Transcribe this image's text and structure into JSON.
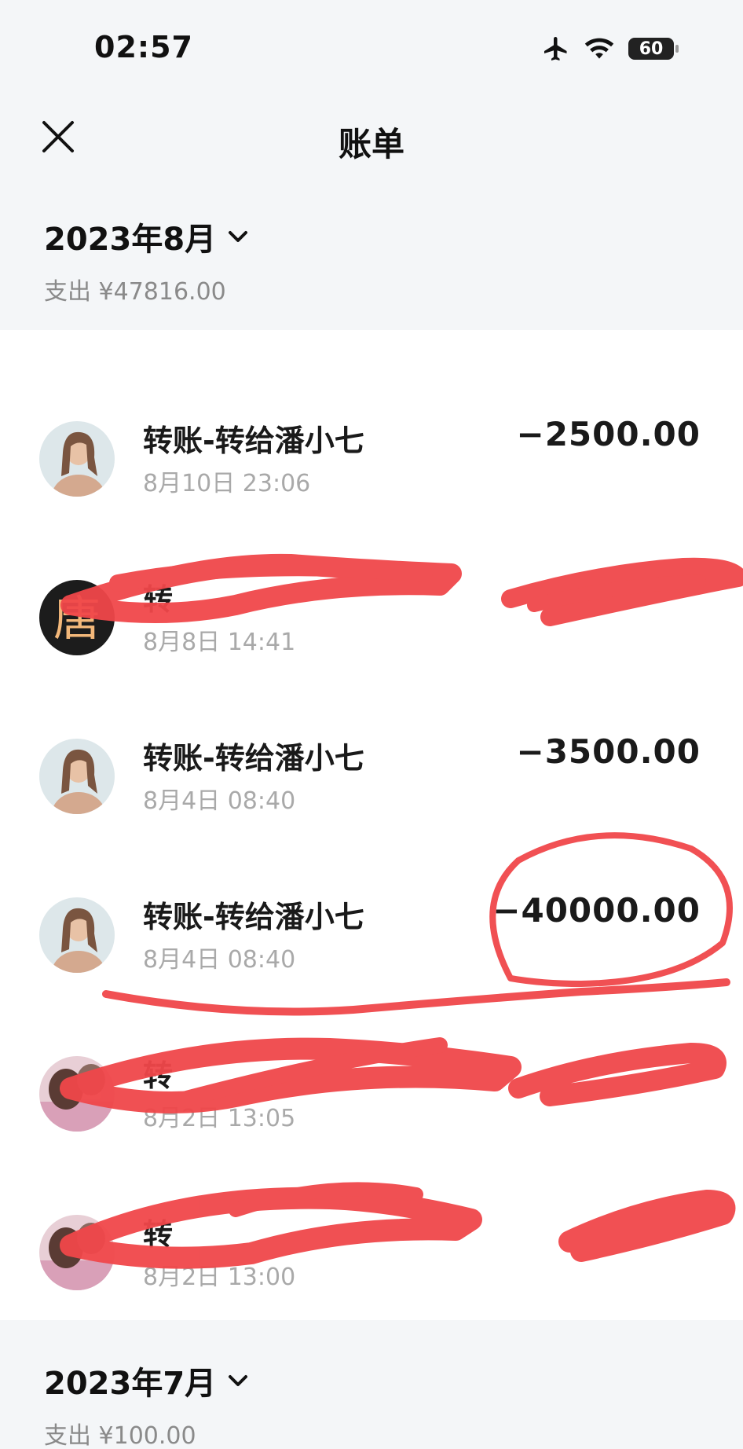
{
  "status_bar": {
    "time": "02:57",
    "battery": "60",
    "icons": [
      "airplane-icon",
      "wifi-icon",
      "battery-icon"
    ]
  },
  "nav": {
    "title": "账单",
    "close_icon": "close-icon"
  },
  "months": [
    {
      "title": "2023年8月",
      "expense": "支出 ¥47816.00"
    },
    {
      "title": "2023年7月",
      "expense": "支出 ¥100.00"
    }
  ],
  "transactions": [
    {
      "title": "转账-转给潘小七",
      "time": "8月10日 23:06",
      "amount": "−2500.00",
      "avatar": "avatar-photo-girl",
      "redacted": false
    },
    {
      "title": "转",
      "time": "8月8日 14:41",
      "amount": "",
      "avatar": "avatar-tang",
      "avatar_text": "唐",
      "redacted": true
    },
    {
      "title": "转账-转给潘小七",
      "time": "8月4日 08:40",
      "amount": "−3500.00",
      "avatar": "avatar-photo-girl",
      "redacted": false
    },
    {
      "title": "转账-转给潘小七",
      "time": "8月4日 08:40",
      "amount": "−40000.00",
      "avatar": "avatar-photo-girl",
      "redacted": false,
      "circled": true
    },
    {
      "title": "转",
      "time": "8月2日 13:05",
      "amount": "",
      "avatar": "avatar-photo-pink",
      "redacted": true
    },
    {
      "title": "转",
      "time": "8月2日 13:00",
      "amount": "",
      "avatar": "avatar-photo-pink",
      "redacted": true
    }
  ],
  "colors": {
    "scribble": "#f0474a",
    "time_gray": "#a9a9a9",
    "subtext_gray": "#8a8a8a"
  }
}
